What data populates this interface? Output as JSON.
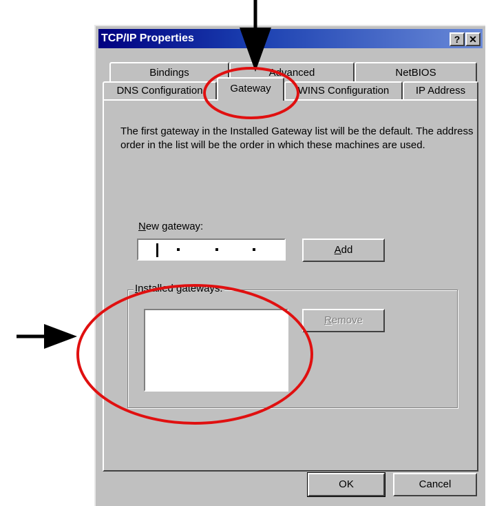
{
  "window": {
    "title": "TCP/IP Properties",
    "help_glyph": "?",
    "close_glyph": "✕"
  },
  "tabs_back": [
    "Bindings",
    "Advanced",
    "NetBIOS"
  ],
  "tabs_front": [
    "DNS Configuration",
    "Gateway",
    "WINS Configuration",
    "IP Address"
  ],
  "active_tab": "Gateway",
  "description": "The first gateway in the Installed Gateway list will be the default. The address order in the list will be the order in which these machines are used.",
  "new_gateway": {
    "label_first": "N",
    "label_rest": "ew gateway:",
    "value": ""
  },
  "add_button": {
    "first": "A",
    "rest": "dd"
  },
  "installed": {
    "label_first": "I",
    "label_rest": "nstalled gateways:",
    "items": []
  },
  "remove_button": {
    "first": "R",
    "rest": "emove",
    "enabled": false
  },
  "ok_label": "OK",
  "cancel_label": "Cancel",
  "colors": {
    "dialog_face": "#c0c0c0",
    "title_bar": "#000080",
    "annotation": "#e01010"
  }
}
